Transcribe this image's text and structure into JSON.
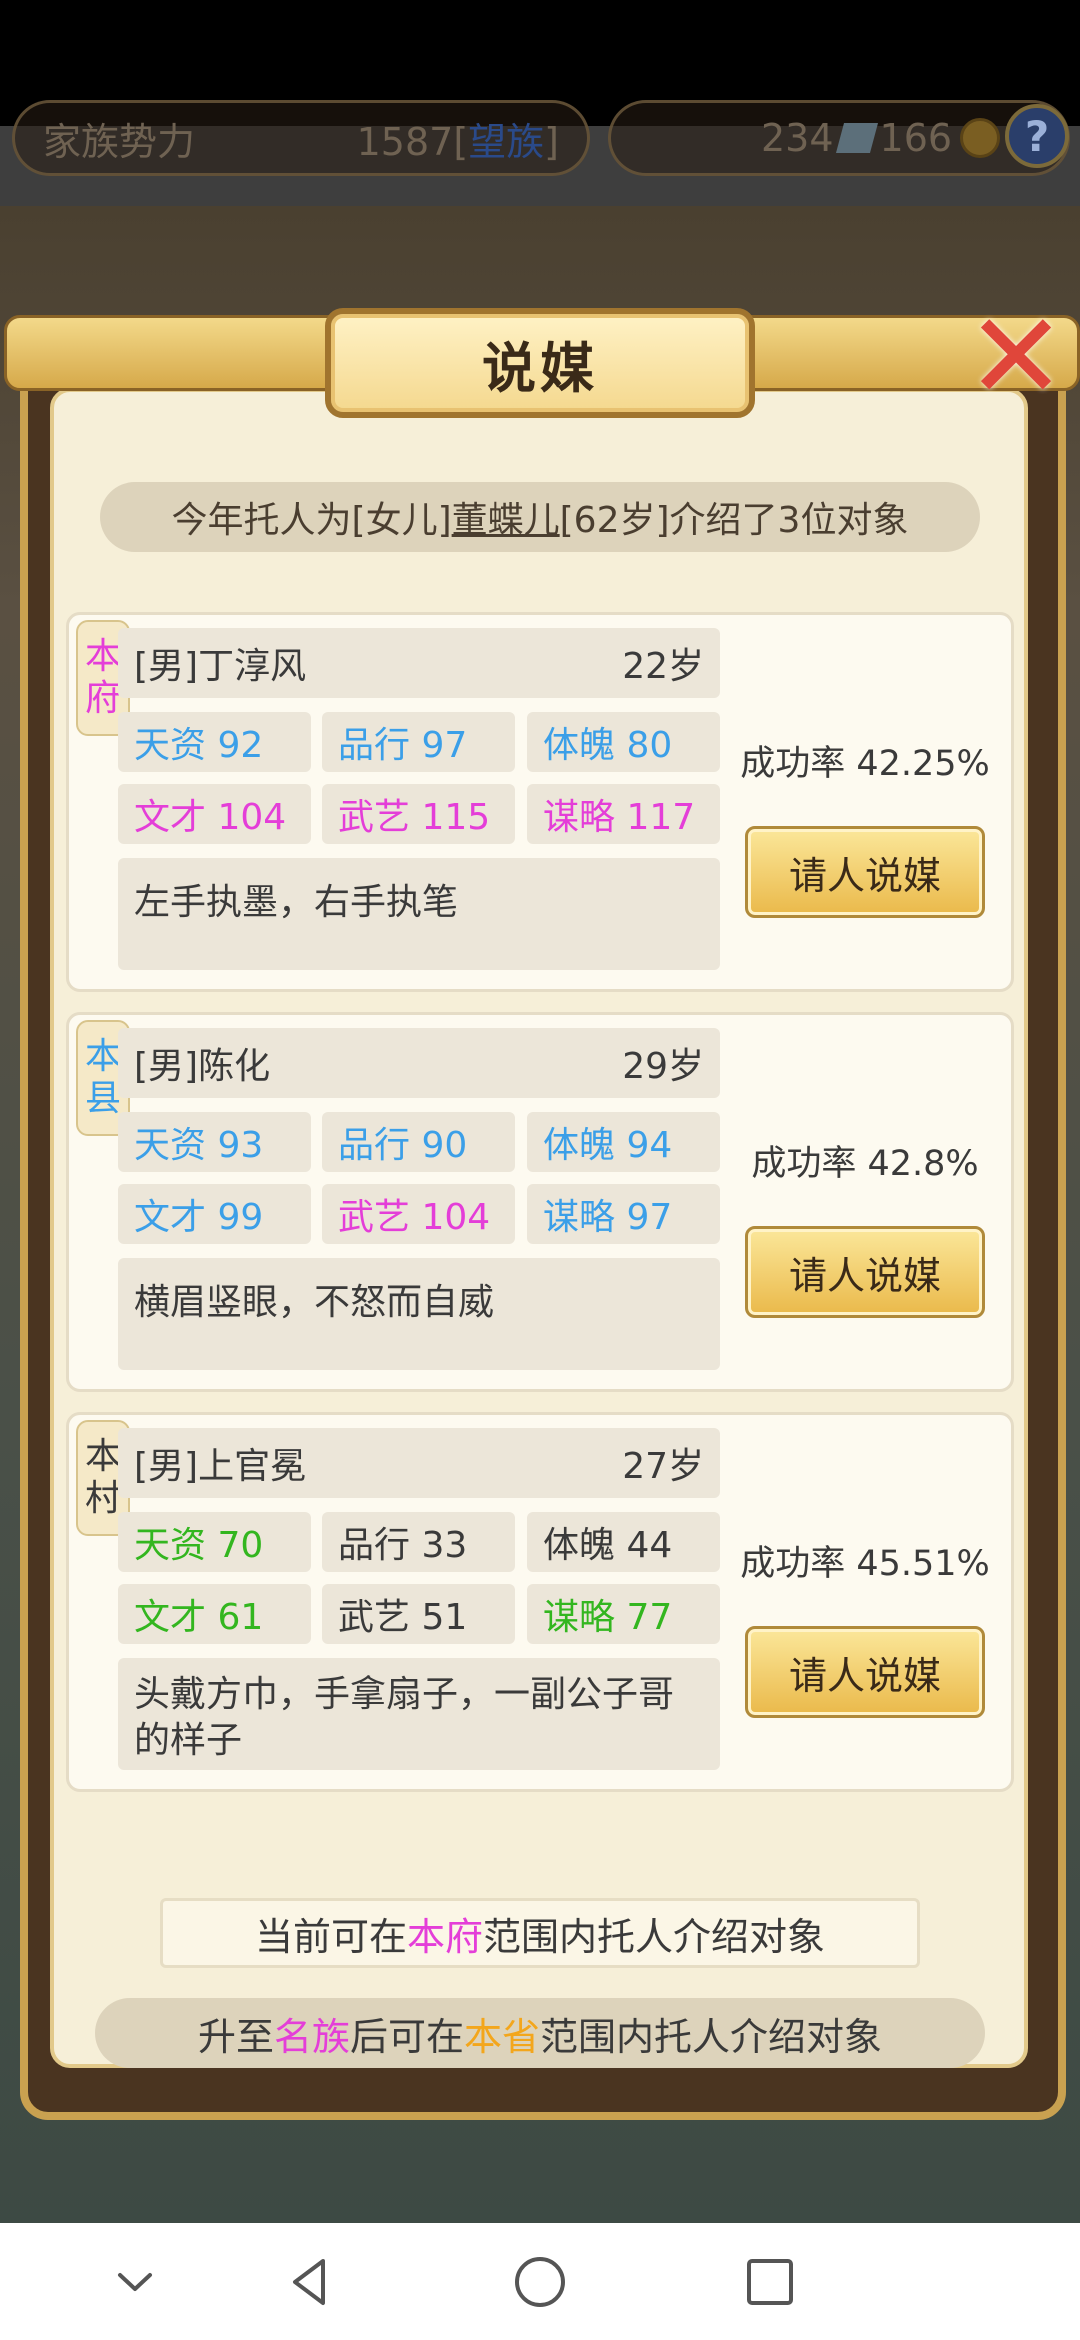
{
  "hud": {
    "family_power_label": "家族势力",
    "family_power_value": "1587",
    "family_rank": "望族",
    "silver": "234",
    "gems": "166",
    "help": "?"
  },
  "dialog": {
    "title": "说媒",
    "close": "✕",
    "intro_prefix": "今年托人为[女儿]",
    "intro_name": "董蝶儿",
    "intro_suffix": "[62岁]介绍了3位对象"
  },
  "candidates": [
    {
      "region_1": "本",
      "region_2": "府",
      "region_color": "#e43ed8",
      "name": "[男]丁淳风",
      "age": "22岁",
      "stats": [
        {
          "label": "天资 92",
          "color": "#3b9fe8"
        },
        {
          "label": "品行 97",
          "color": "#3b9fe8"
        },
        {
          "label": "体魄 80",
          "color": "#3b9fe8"
        },
        {
          "label": "文才 104",
          "color": "#e43ed8"
        },
        {
          "label": "武艺 115",
          "color": "#e43ed8"
        },
        {
          "label": "谋略 117",
          "color": "#e43ed8"
        }
      ],
      "desc": "左手执墨，右手执笔",
      "rate": "成功率 42.25%",
      "button": "请人说媒"
    },
    {
      "region_1": "本",
      "region_2": "县",
      "region_color": "#3b9fe8",
      "name": "[男]陈化",
      "age": "29岁",
      "stats": [
        {
          "label": "天资 93",
          "color": "#3b9fe8"
        },
        {
          "label": "品行 90",
          "color": "#3b9fe8"
        },
        {
          "label": "体魄 94",
          "color": "#3b9fe8"
        },
        {
          "label": "文才 99",
          "color": "#3b9fe8"
        },
        {
          "label": "武艺 104",
          "color": "#e43ed8"
        },
        {
          "label": "谋略 97",
          "color": "#3b9fe8"
        }
      ],
      "desc": "横眉竖眼，不怒而自威",
      "rate": "成功率 42.8%",
      "button": "请人说媒"
    },
    {
      "region_1": "本",
      "region_2": "村",
      "region_color": "#3a3a3a",
      "name": "[男]上官冕",
      "age": "27岁",
      "stats": [
        {
          "label": "天资 70",
          "color": "#33b61f"
        },
        {
          "label": "品行 33",
          "color": "#3a3a3a"
        },
        {
          "label": "体魄 44",
          "color": "#3a3a3a"
        },
        {
          "label": "文才 61",
          "color": "#33b61f"
        },
        {
          "label": "武艺 51",
          "color": "#3a3a3a"
        },
        {
          "label": "谋略 77",
          "color": "#33b61f"
        }
      ],
      "desc": "头戴方巾，手拿扇子，一副公子哥的样子",
      "rate": "成功率 45.51%",
      "button": "请人说媒"
    }
  ],
  "footer": {
    "line1_a": "当前可在",
    "line1_b": "本府",
    "line1_c": "范围内托人介绍对象",
    "line2_a": "升至",
    "line2_b": "名族",
    "line2_c": "后可在",
    "line2_d": "本省",
    "line2_e": "范围内托人介绍对象"
  },
  "nav": {
    "icons": [
      "chevron-down-icon",
      "back-triangle-icon",
      "home-circle-icon",
      "recents-square-icon"
    ]
  }
}
